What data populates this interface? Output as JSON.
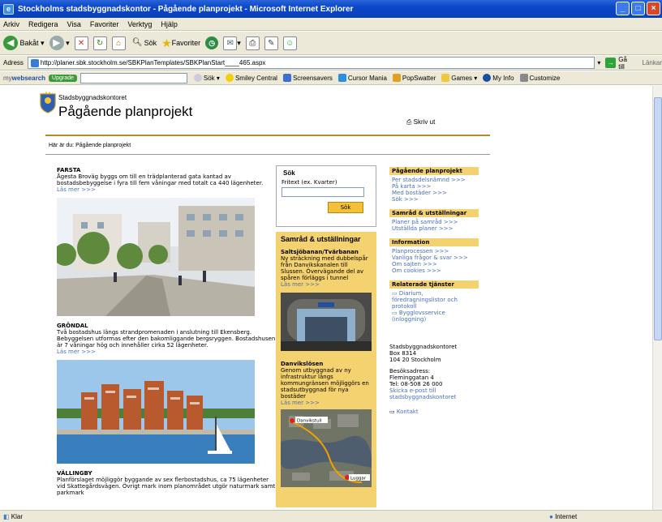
{
  "window": {
    "title": "Stockholms stadsbyggnadskontor - Pågående planprojekt - Microsoft Internet Explorer"
  },
  "menu": [
    "Arkiv",
    "Redigera",
    "Visa",
    "Favoriter",
    "Verktyg",
    "Hjälp"
  ],
  "toolbar": {
    "back": "Bakåt",
    "search": "Sök",
    "favorites": "Favoriter"
  },
  "address": {
    "label": "Adress",
    "url": "http://planer.sbk.stockholm.se/SBKPlanTemplates/SBKPlanStart____465.aspx",
    "go": "Gå till",
    "links": "Länkar"
  },
  "linkbar": {
    "brand_a": "my",
    "brand_b": "websearch",
    "upgrade": "Upgrade",
    "search": "Sök",
    "items": [
      "Smiley Central",
      "Screensavers",
      "Cursor Mania",
      "PopSwatter",
      "Games",
      "My Info",
      "Customize"
    ]
  },
  "header": {
    "org": "Stadsbyggnadskontoret",
    "title": "Pågående planprojekt",
    "print": "Skriv ut",
    "crumb": "Här är du: Pågående planprojekt"
  },
  "projects": [
    {
      "title": "FARSTA",
      "text": "Ågesta Broväg byggs om till en trädplanterad gata kantad av bostadsbebyggelse i fyra till fem våningar med totalt ca 440 lägenheter.",
      "more": "Läs mer >>>"
    },
    {
      "title": "GRÖNDAL",
      "text": "Två bostadshus längs strandpromenaden i anslutning till Ekensberg. Bebyggelsen utformas efter den bakomliggande bergsryggen. Bostadshusen är 7 våningar hög och innehåller cirka 52 lägenheter.",
      "more": "Läs mer >>>"
    },
    {
      "title": "VÄLLINGBY",
      "text": "Planförslaget möjliggör byggande av sex flerbostadshus, ca 75 lägenheter vid Skattegårdsvägen. Övrigt mark inom planområdet utgör naturmark samt parkmark"
    }
  ],
  "search": {
    "title": "Sök",
    "label": "Fritext (ex. Kvarter)",
    "button": "Sök"
  },
  "samrad": {
    "title": "Samråd & utställningar",
    "items": [
      {
        "title": "Saltsjöbanan/Tvärbanan",
        "text": "Ny sträckning med dubbelspår från Danvikskanalen till Slussen. Övervägande del av spåren förläggs i tunnel",
        "more": "Läs mer >>>"
      },
      {
        "title": "Danvikslösen",
        "text": "Genom utbyggnad av ny infrastruktur längs kommungränsen möjliggörs en stadsutbyggnad för nya bostäder",
        "more": "Läs mer >>>"
      }
    ],
    "map_labels": [
      "Danvikstull",
      "Luggar"
    ]
  },
  "sidebar": [
    {
      "heading": "Pågående planprojekt",
      "links": [
        "Per stadsdelsnämnd >>>",
        "På karta >>>",
        "Med bostäder >>>",
        "Sök >>>"
      ]
    },
    {
      "heading": "Samråd & utställningar",
      "links": [
        "Planer på samråd >>>",
        "Utställda planer >>>"
      ]
    },
    {
      "heading": "Information",
      "links": [
        "Planprocessen >>>",
        "Vanliga frågor & svar >>>",
        "Om sajten >>>",
        "Om cookies >>>"
      ]
    },
    {
      "heading": "Relaterade tjänster",
      "links": [
        "Diarium, föredragningslistor och protokoll",
        "Bygglovsservice (inloggning)"
      ]
    }
  ],
  "contact": {
    "org": "Stadsbyggnadskontoret",
    "box": "Box 8314",
    "city": "104 20 Stockholm",
    "visit_label": "Besöksadress:",
    "street": "Fleminggatan 4",
    "tel": "Tel: 08-508 26 000",
    "email": "Skicka e-post till stadsbyggnadskontoret",
    "kontakt": "Kontakt"
  },
  "status": {
    "left": "Klar",
    "right": "Internet"
  }
}
